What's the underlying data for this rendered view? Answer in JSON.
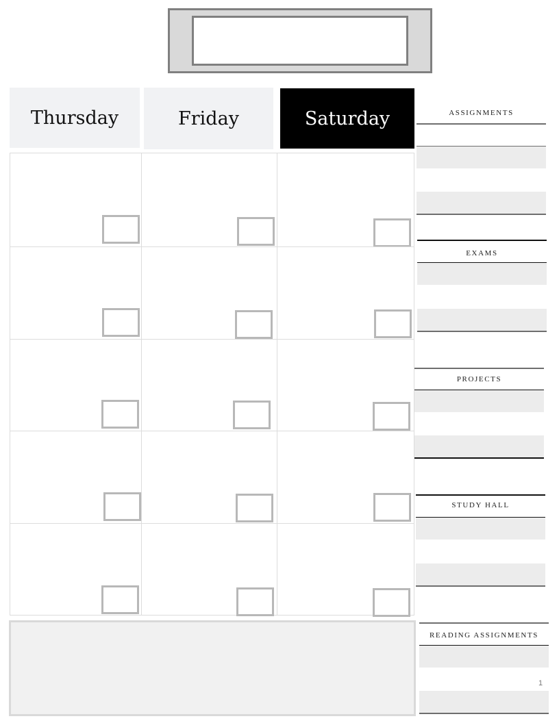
{
  "title_banner": {
    "text": ""
  },
  "days": [
    {
      "label": "Thursday",
      "highlighted": false
    },
    {
      "label": "Friday",
      "highlighted": false
    },
    {
      "label": "Saturday",
      "highlighted": true
    }
  ],
  "grid": {
    "rows": 5,
    "columns": 3
  },
  "notes": {
    "text": ""
  },
  "sidebar": {
    "sections": [
      {
        "title": "ASSIGNMENTS"
      },
      {
        "title": "EXAMS"
      },
      {
        "title": "PROJECTS"
      },
      {
        "title": "STUDY HALL"
      },
      {
        "title": "READING ASSIGNMENTS"
      }
    ]
  },
  "page_number": "1",
  "colors": {
    "header_light": "#f1f2f4",
    "header_highlight": "#000000",
    "banner_fill": "#d9d9d9",
    "banner_border": "#808080",
    "checkbox_border": "#b8b8b8",
    "row_shade": "#ececec",
    "notes_fill": "#f1f1f1"
  }
}
